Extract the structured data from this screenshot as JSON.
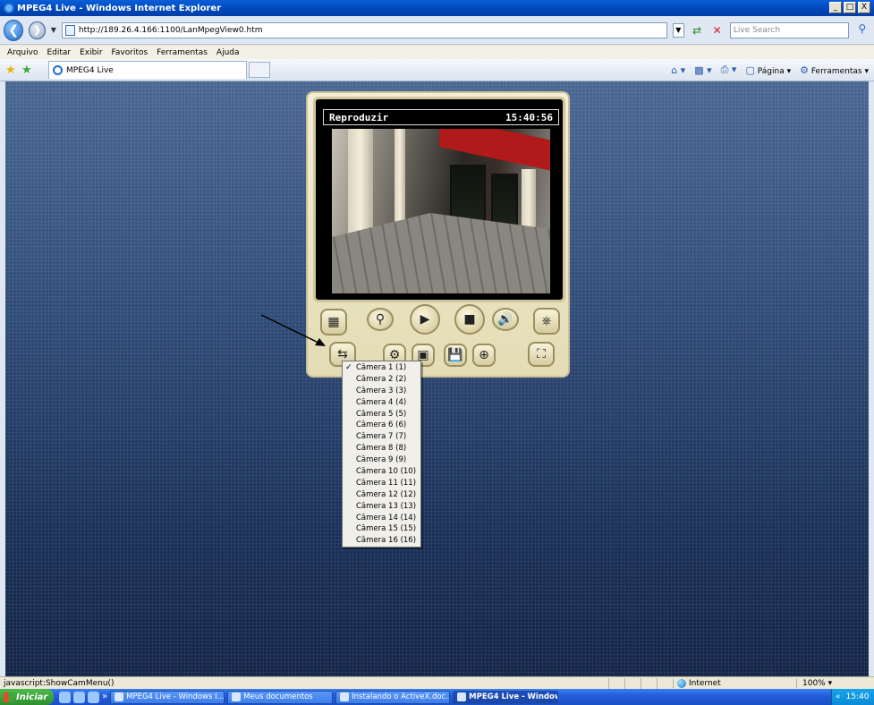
{
  "window": {
    "title": "MPEG4 Live - Windows Internet Explorer",
    "controls": [
      "_",
      "□",
      "X"
    ]
  },
  "addressbar": {
    "url": "http://189.26.4.166:1100/LanMpegView0.htm",
    "search_placeholder": "Live Search"
  },
  "menubar": {
    "items": [
      "Arquivo",
      "Editar",
      "Exibir",
      "Favoritos",
      "Ferramentas",
      "Ajuda"
    ]
  },
  "tabs": {
    "active_label": "MPEG4 Live"
  },
  "commandbar": {
    "page_label": "Página",
    "tools_label": "Ferramentas"
  },
  "player": {
    "status": "Reproduzir",
    "time": "15:40:56"
  },
  "camera_menu": {
    "selected_index": 0,
    "items": [
      "Câmera 1 (1)",
      "Câmera 2 (2)",
      "Câmera 3 (3)",
      "Câmera 4 (4)",
      "Câmera 5 (5)",
      "Câmera 6 (6)",
      "Câmera 7 (7)",
      "Câmera 8 (8)",
      "Câmera 9 (9)",
      "Câmera 10 (10)",
      "Câmera 11 (11)",
      "Câmera 12 (12)",
      "Câmera 13 (13)",
      "Câmera 14 (14)",
      "Câmera 15 (15)",
      "Câmera 16 (16)"
    ]
  },
  "statusbar": {
    "text": "javascript:ShowCamMenu()",
    "zone": "Internet",
    "zoom": "100%"
  },
  "taskbar": {
    "start_label": "Iniciar",
    "tasks": [
      {
        "label": "MPEG4 Live - Windows I...",
        "active": false
      },
      {
        "label": "Meus documentos",
        "active": false
      },
      {
        "label": "Instalando o ActiveX.doc...",
        "active": false
      },
      {
        "label": "MPEG4 Live - Window...",
        "active": true
      }
    ],
    "clock": "15:40"
  },
  "colors": {
    "page_bg_top": "#4a6793",
    "page_bg_bottom": "#142548",
    "osd_text": "#ffffff",
    "player_frame": "#e3dcb5"
  }
}
